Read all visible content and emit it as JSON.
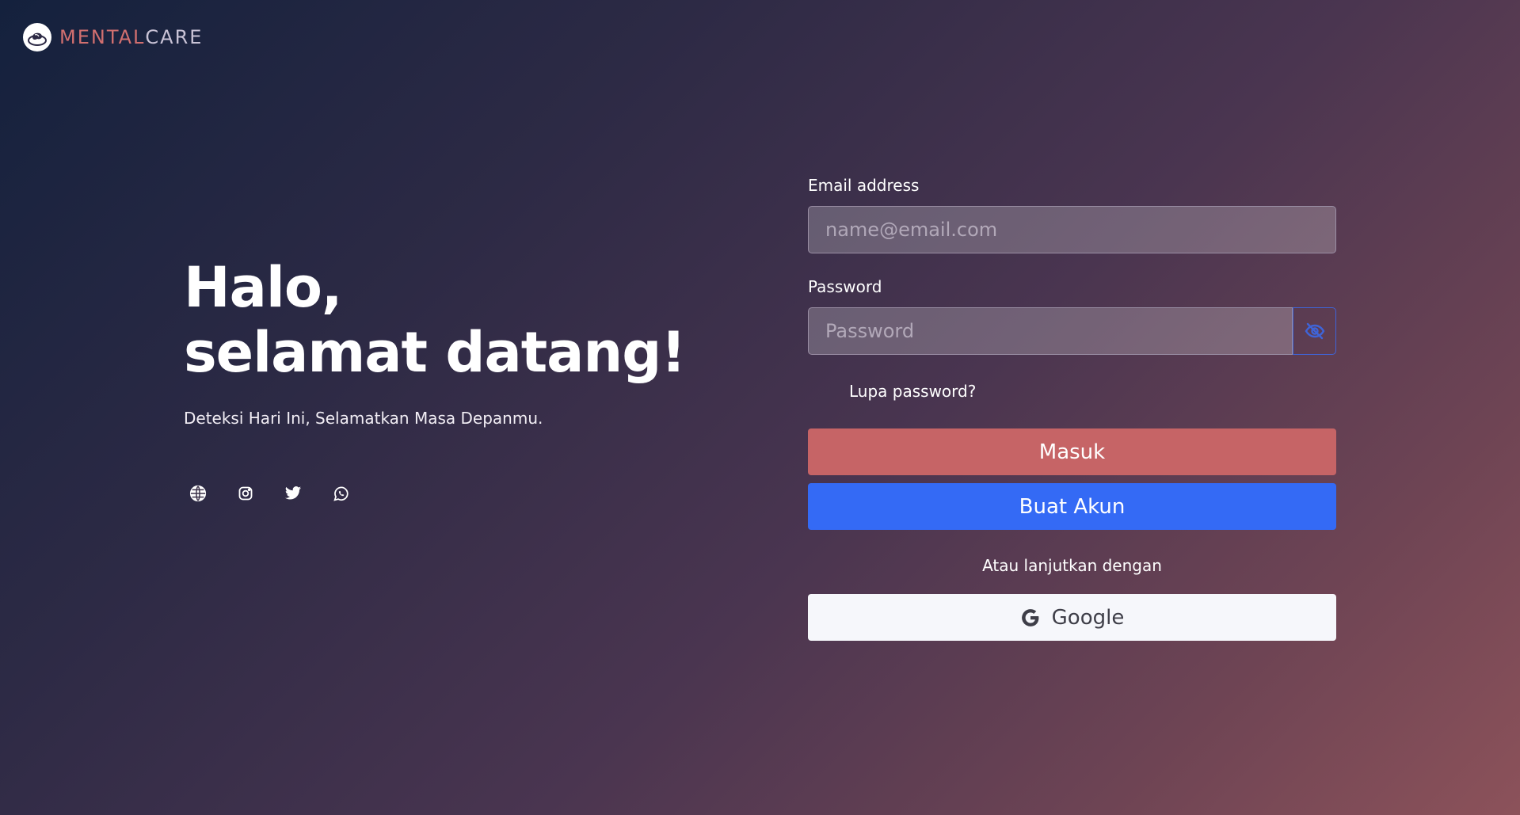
{
  "brand": {
    "part1": "MENTAL",
    "part2": "CARE",
    "accent_color": "#d16f6f"
  },
  "hero": {
    "title_line1": "Halo,",
    "title_line2": "selamat datang!",
    "subtitle": "Deteksi Hari Ini, Selamatkan Masa Depanmu."
  },
  "socials": [
    {
      "icon": "globe-icon"
    },
    {
      "icon": "instagram-icon"
    },
    {
      "icon": "twitter-icon"
    },
    {
      "icon": "whatsapp-icon"
    }
  ],
  "form": {
    "email_label": "Email address",
    "email_placeholder": "name@email.com",
    "email_value": "",
    "password_label": "Password",
    "password_placeholder": "Password",
    "password_value": "",
    "toggle_icon": "eye-slash-icon",
    "forgot_link": "Lupa password?",
    "login_button": "Masuk",
    "login_color": "#c66466",
    "register_button": "Buat Akun",
    "register_color": "#346af5",
    "divider_text": "Atau lanjutkan dengan",
    "google_button": "Google",
    "google_icon": "google-icon"
  }
}
